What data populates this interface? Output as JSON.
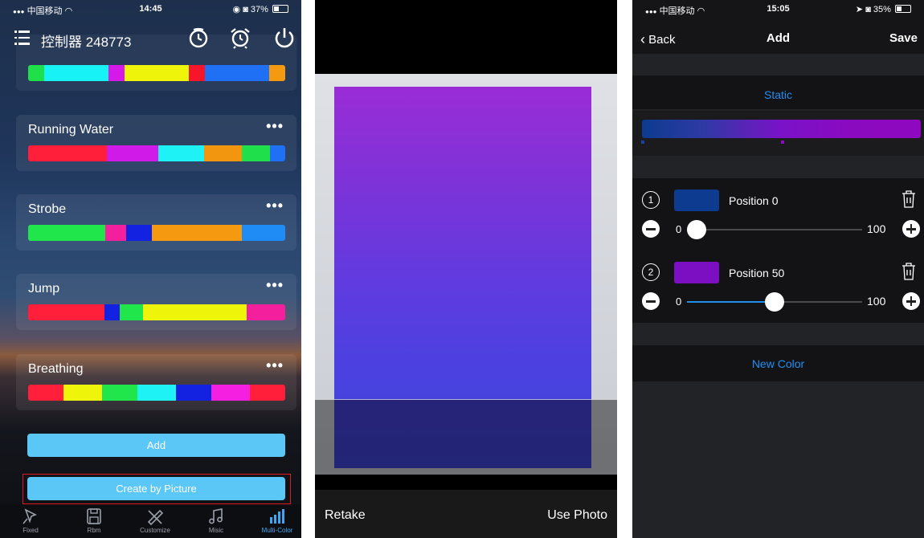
{
  "panel1": {
    "status": {
      "carrier": "中国移动",
      "time": "14:45",
      "battery": "37%"
    },
    "title": "控制器 248773",
    "effects": [
      {
        "name": "",
        "colors": [
          "#1fe04a",
          "#17f2f7",
          "#17f2f7",
          "#17f2f7",
          "#d419e8",
          "#eef50a",
          "#eef50a",
          "#eef50a",
          "#f5162a",
          "#1f70f5",
          "#1f70f5",
          "#1f70f5",
          "#1f70f5",
          "#f59a10"
        ],
        "weights": [
          1.0,
          4.0,
          0,
          0,
          1.0,
          4.0,
          0,
          0,
          1.0,
          4.0,
          0,
          0,
          0,
          1.0
        ]
      },
      {
        "name": "Running Water",
        "colors": [
          "#ff1f3a",
          "#cf1ae8",
          "#1ff2f5",
          "#f2960f",
          "#1fe04a",
          "#1f70f5"
        ],
        "weights": [
          3.1,
          2.0,
          1.8,
          1.5,
          1.1,
          0.6
        ]
      },
      {
        "name": "Strobe",
        "colors": [
          "#20e54b",
          "#f41f9c",
          "#1322e0",
          "#f59a10",
          "#1f8cf5"
        ],
        "weights": [
          3.0,
          0.8,
          1.0,
          3.5,
          1.7
        ]
      },
      {
        "name": "Jump",
        "colors": [
          "#ff1f3a",
          "#1322e0",
          "#20e54b",
          "#eef50a",
          "#f41f9c"
        ],
        "weights": [
          3.0,
          0.6,
          0.9,
          4.1,
          1.5
        ]
      },
      {
        "name": "Breathing",
        "colors": [
          "#ff1f3a",
          "#eef50a",
          "#20e54b",
          "#1ff2f5",
          "#1322e0",
          "#f41fe0",
          "#ff1f3a"
        ],
        "weights": [
          1.4,
          1.5,
          1.4,
          1.5,
          1.4,
          1.5,
          1.4
        ]
      }
    ],
    "more_label": "•••",
    "add_label": "Add",
    "create_label": "Create by Picture",
    "tabs": [
      {
        "label": "Fixed",
        "icon": "pin-icon"
      },
      {
        "label": "Rbm",
        "icon": "save-icon"
      },
      {
        "label": "Customize",
        "icon": "pencil-icon"
      },
      {
        "label": "Misic",
        "icon": "music-icon"
      },
      {
        "label": "Multi-Color",
        "icon": "bars-icon",
        "active": true
      }
    ]
  },
  "panel2": {
    "retake": "Retake",
    "use_photo": "Use Photo"
  },
  "panel3": {
    "status": {
      "carrier": "中国移动",
      "time": "15:05",
      "battery": "35%"
    },
    "back": "Back",
    "title": "Add",
    "save": "Save",
    "static_label": "Static",
    "colors": [
      {
        "num": "1",
        "swatch": "#0c3b8f",
        "label": "Position 0",
        "min": "0",
        "max": "100",
        "value": 0
      },
      {
        "num": "2",
        "swatch": "#7d0fc3",
        "label": "Position 50",
        "min": "0",
        "max": "100",
        "value": 50
      }
    ],
    "new_color": "New Color",
    "accent": "#1f8ff2"
  }
}
